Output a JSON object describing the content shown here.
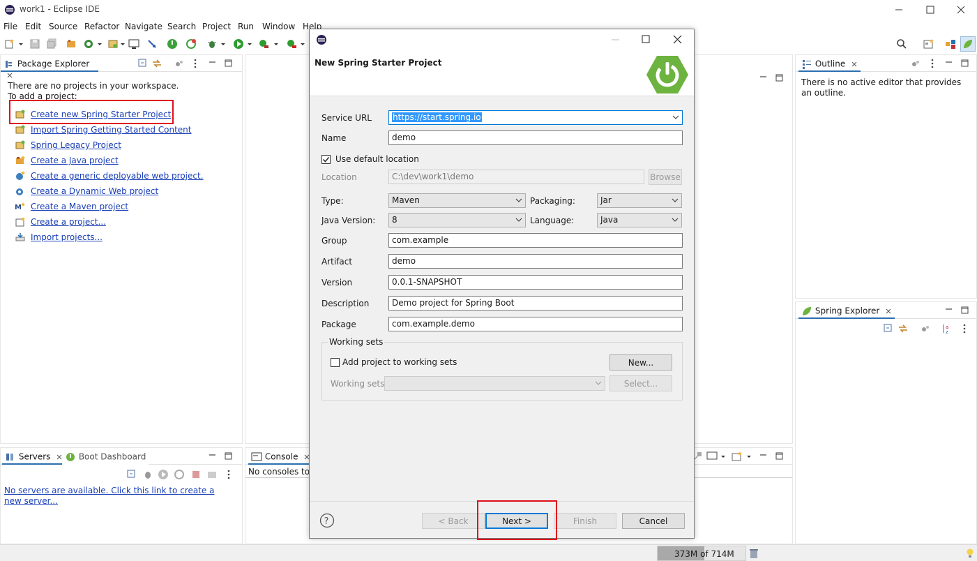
{
  "window": {
    "title": "work1 - Eclipse IDE"
  },
  "menu": [
    "File",
    "Edit",
    "Source",
    "Refactor",
    "Navigate",
    "Search",
    "Project",
    "Run",
    "Window",
    "Help"
  ],
  "package_explorer": {
    "tab_label": "Package Explorer",
    "empty_line1": "There are no projects in your workspace.",
    "empty_line2": "To add a project:",
    "links": [
      "Create new Spring Starter Project",
      "Import Spring Getting Started Content",
      "Spring Legacy Project",
      "Create a Java project",
      "Create a generic deployable web project.",
      "Create a Dynamic Web project",
      "Create a Maven project",
      "Create a project...",
      "Import projects..."
    ]
  },
  "outline": {
    "tab_label": "Outline",
    "message": "There is no active editor that provides an outline."
  },
  "spring_explorer": {
    "tab_label": "Spring Explorer"
  },
  "servers": {
    "tab_label": "Servers",
    "boot_tab_label": "Boot Dashboard",
    "message": "No servers are available. Click this link to create a new server..."
  },
  "console": {
    "tab_label": "Console",
    "message": "No consoles to d"
  },
  "status": {
    "memory": "373M of 714M"
  },
  "dialog": {
    "title": "New Spring Starter Project",
    "service_url_label": "Service URL",
    "service_url": "https://start.spring.io",
    "name_label": "Name",
    "name": "demo",
    "use_default_label": "Use default location",
    "location_label": "Location",
    "location": "C:\\dev\\work1\\demo",
    "browse_label": "Browse",
    "type_label": "Type:",
    "type": "Maven",
    "packaging_label": "Packaging:",
    "packaging": "Jar",
    "java_version_label": "Java Version:",
    "java_version": "8",
    "language_label": "Language:",
    "language": "Java",
    "group_label": "Group",
    "group": "com.example",
    "artifact_label": "Artifact",
    "artifact": "demo",
    "version_label": "Version",
    "version": "0.0.1-SNAPSHOT",
    "description_label": "Description",
    "description": "Demo project for Spring Boot",
    "package_label": "Package",
    "package": "com.example.demo",
    "working_sets_group": "Working sets",
    "add_ws_label": "Add project to working sets",
    "new_label": "New...",
    "working_sets_label": "Working sets:",
    "select_label": "Select...",
    "back_label": "< Back",
    "next_label": "Next >",
    "finish_label": "Finish",
    "cancel_label": "Cancel"
  },
  "colors": {
    "accent": "#0078d7",
    "highlight": "#e0101c",
    "link": "#1a3fb7",
    "spring_green": "#6db33f"
  }
}
